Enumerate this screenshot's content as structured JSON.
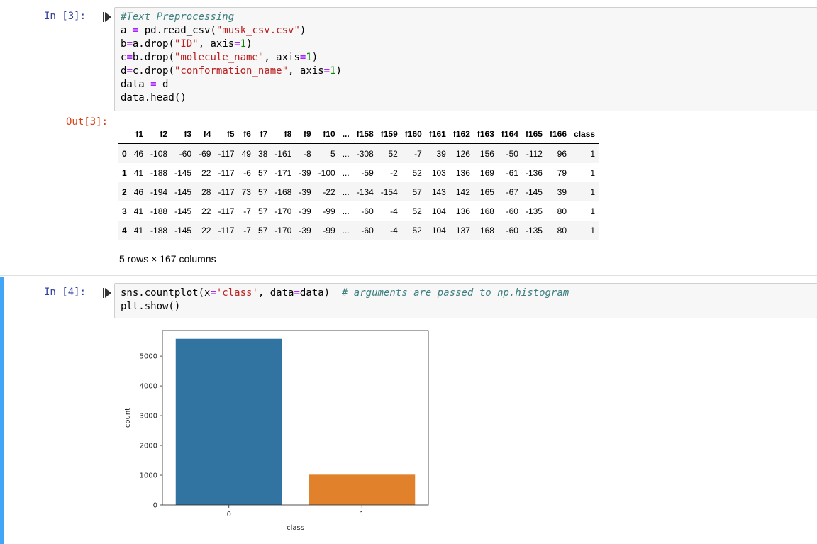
{
  "cells": [
    {
      "prompt": "In [3]:",
      "code": [
        [
          {
            "t": "#Text Preprocessing",
            "c": "cm-comment"
          }
        ],
        [
          {
            "t": "a "
          },
          {
            "t": "=",
            "c": "cm-op"
          },
          {
            "t": " pd.read_csv("
          },
          {
            "t": "\"musk_csv.csv\"",
            "c": "cm-string"
          },
          {
            "t": ")"
          }
        ],
        [
          {
            "t": "b"
          },
          {
            "t": "=",
            "c": "cm-op"
          },
          {
            "t": "a.drop("
          },
          {
            "t": "\"ID\"",
            "c": "cm-string"
          },
          {
            "t": ", axis"
          },
          {
            "t": "=",
            "c": "cm-op"
          },
          {
            "t": "1",
            "c": "cm-number"
          },
          {
            "t": ")"
          }
        ],
        [
          {
            "t": "c"
          },
          {
            "t": "=",
            "c": "cm-op"
          },
          {
            "t": "b.drop("
          },
          {
            "t": "\"molecule_name\"",
            "c": "cm-string"
          },
          {
            "t": ", axis"
          },
          {
            "t": "=",
            "c": "cm-op"
          },
          {
            "t": "1",
            "c": "cm-number"
          },
          {
            "t": ")"
          }
        ],
        [
          {
            "t": "d"
          },
          {
            "t": "=",
            "c": "cm-op"
          },
          {
            "t": "c.drop("
          },
          {
            "t": "\"conformation_name\"",
            "c": "cm-string"
          },
          {
            "t": ", axis"
          },
          {
            "t": "=",
            "c": "cm-op"
          },
          {
            "t": "1",
            "c": "cm-number"
          },
          {
            "t": ")"
          }
        ],
        [
          {
            "t": "data "
          },
          {
            "t": "=",
            "c": "cm-op"
          },
          {
            "t": " d"
          }
        ],
        [
          {
            "t": "data.head()"
          }
        ]
      ],
      "out_prompt": "Out[3]:",
      "table": {
        "columns": [
          "",
          "f1",
          "f2",
          "f3",
          "f4",
          "f5",
          "f6",
          "f7",
          "f8",
          "f9",
          "f10",
          "...",
          "f158",
          "f159",
          "f160",
          "f161",
          "f162",
          "f163",
          "f164",
          "f165",
          "f166",
          "class"
        ],
        "rows": [
          [
            "0",
            "46",
            "-108",
            "-60",
            "-69",
            "-117",
            "49",
            "38",
            "-161",
            "-8",
            "5",
            "...",
            "-308",
            "52",
            "-7",
            "39",
            "126",
            "156",
            "-50",
            "-112",
            "96",
            "1"
          ],
          [
            "1",
            "41",
            "-188",
            "-145",
            "22",
            "-117",
            "-6",
            "57",
            "-171",
            "-39",
            "-100",
            "...",
            "-59",
            "-2",
            "52",
            "103",
            "136",
            "169",
            "-61",
            "-136",
            "79",
            "1"
          ],
          [
            "2",
            "46",
            "-194",
            "-145",
            "28",
            "-117",
            "73",
            "57",
            "-168",
            "-39",
            "-22",
            "...",
            "-134",
            "-154",
            "57",
            "143",
            "142",
            "165",
            "-67",
            "-145",
            "39",
            "1"
          ],
          [
            "3",
            "41",
            "-188",
            "-145",
            "22",
            "-117",
            "-7",
            "57",
            "-170",
            "-39",
            "-99",
            "...",
            "-60",
            "-4",
            "52",
            "104",
            "136",
            "168",
            "-60",
            "-135",
            "80",
            "1"
          ],
          [
            "4",
            "41",
            "-188",
            "-145",
            "22",
            "-117",
            "-7",
            "57",
            "-170",
            "-39",
            "-99",
            "...",
            "-60",
            "-4",
            "52",
            "104",
            "137",
            "168",
            "-60",
            "-135",
            "80",
            "1"
          ]
        ]
      },
      "row_count": "5 rows × 167 columns"
    },
    {
      "prompt": "In [4]:",
      "code": [
        [
          {
            "t": "sns.countplot(x"
          },
          {
            "t": "=",
            "c": "cm-op"
          },
          {
            "t": "'class'",
            "c": "cm-string"
          },
          {
            "t": ", data"
          },
          {
            "t": "=",
            "c": "cm-op"
          },
          {
            "t": "data)  "
          },
          {
            "t": "# arguments are passed to np.histogram",
            "c": "cm-comment"
          }
        ],
        [
          {
            "t": "plt.show()"
          }
        ]
      ]
    }
  ],
  "chart_data": {
    "type": "bar",
    "categories": [
      "0",
      "1"
    ],
    "values": [
      5581,
      1017
    ],
    "colors": [
      "#3274a1",
      "#e1812c"
    ],
    "xlabel": "class",
    "ylabel": "count",
    "yticks": [
      0,
      1000,
      2000,
      3000,
      4000,
      5000
    ],
    "ylim": [
      0,
      5860
    ],
    "grid": false
  },
  "colors": {
    "in_prompt": "#303f9f",
    "out_prompt": "#d84315",
    "active_cell_bar": "#42a5f5"
  },
  "icons": [
    "run-icon"
  ]
}
